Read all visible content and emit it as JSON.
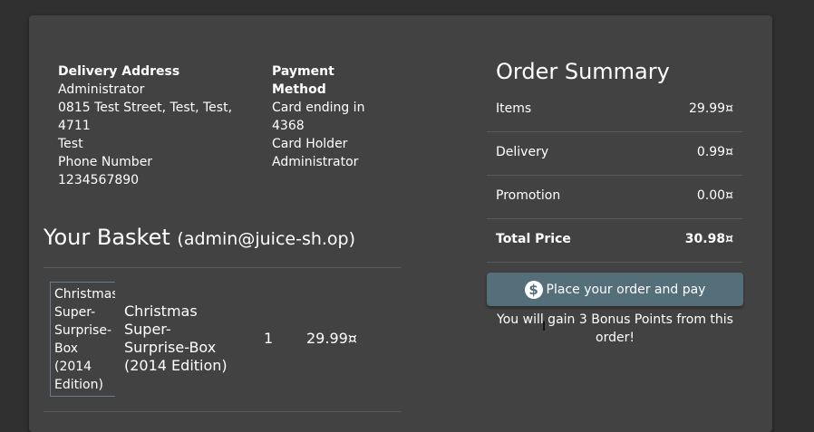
{
  "delivery": {
    "heading": "Delivery Address",
    "name": "Administrator",
    "street": "0815 Test Street, Test, Test, 4711",
    "country": "Test",
    "phone_label": "Phone Number",
    "phone": "1234567890"
  },
  "payment": {
    "heading": "Payment Method",
    "card": "Card ending in 4368",
    "holder_label": "Card Holder",
    "holder": "Administrator"
  },
  "basket": {
    "title": "Your Basket",
    "email": "(admin@juice-sh.op)",
    "items": [
      {
        "image_alt": "Christmas Super-Surprise-Box (2014 Edition)",
        "name": "Christmas Super-Surprise-Box (2014 Edition)",
        "quantity": "1",
        "price": "29.99¤"
      }
    ]
  },
  "summary": {
    "title": "Order Summary",
    "rows": [
      {
        "label": "Items",
        "value": "29.99¤"
      },
      {
        "label": "Delivery",
        "value": "0.99¤"
      },
      {
        "label": "Promotion",
        "value": "0.00¤"
      },
      {
        "label": "Total Price",
        "value": "30.98¤"
      }
    ],
    "place_order_label": "Place your order and pay",
    "bonus_text": "You will gain 3 Bonus Points from this order!"
  },
  "colors": {
    "background": "#303030",
    "card": "#424242",
    "button": "#546e7a"
  },
  "icons": {
    "place_order": "dollar-icon"
  }
}
